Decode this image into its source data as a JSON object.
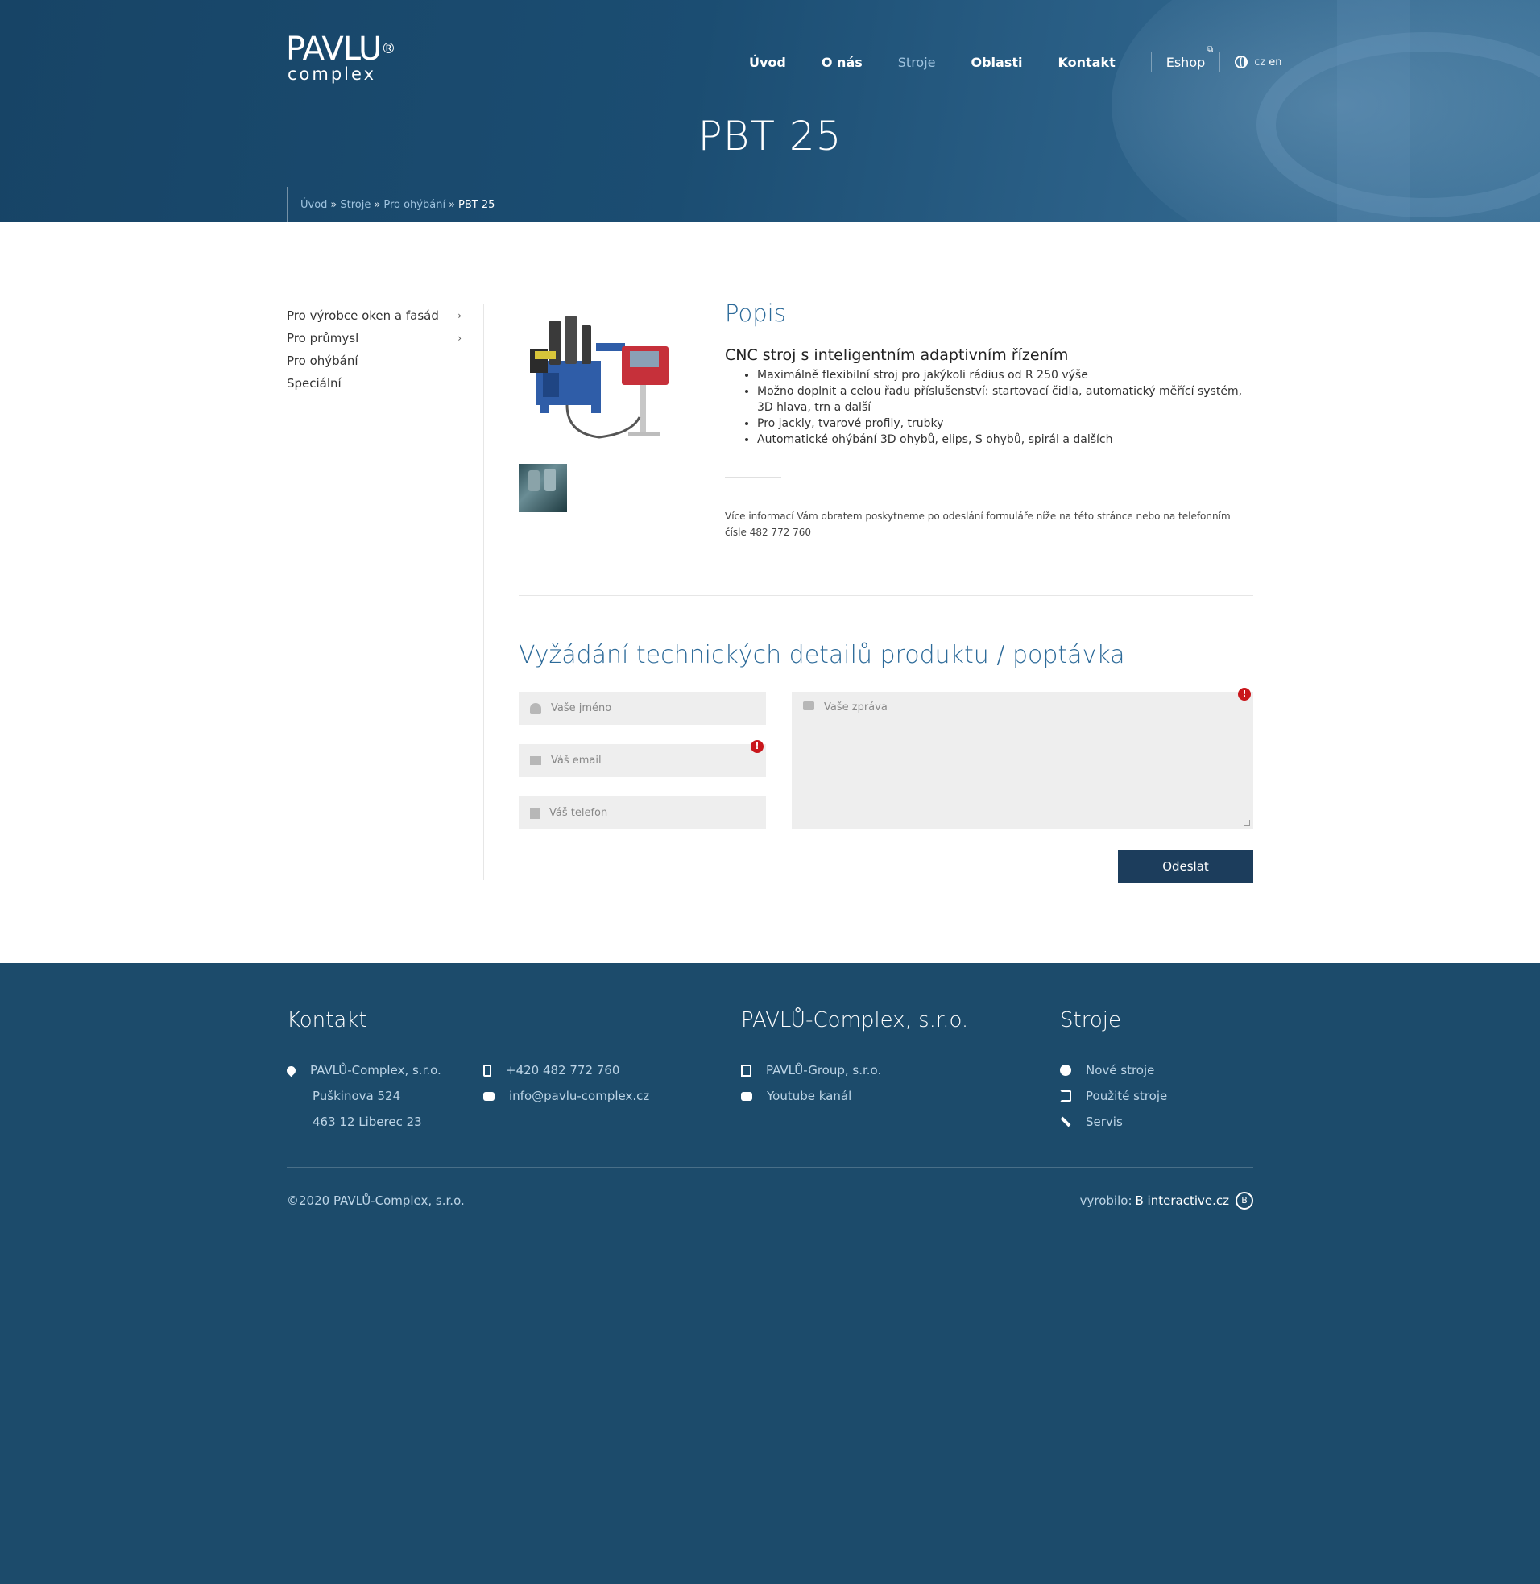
{
  "header": {
    "logo_top": "PAVLU",
    "logo_reg": "®",
    "logo_bottom": "complex",
    "nav": [
      "Úvod",
      "O nás",
      "Stroje",
      "Oblasti",
      "Kontakt"
    ],
    "nav_active": "Stroje",
    "eshop": "Eshop",
    "lang_cz": "cz",
    "lang_en": "en",
    "page_title": "PBT 25",
    "breadcrumb": [
      "Úvod",
      "Stroje",
      "Pro ohýbání",
      "PBT 25"
    ],
    "breadcrumb_sep": "»"
  },
  "sidebar": {
    "items": [
      {
        "label": "Pro výrobce oken a fasád",
        "has_sub": true
      },
      {
        "label": "Pro průmysl",
        "has_sub": true
      },
      {
        "label": "Pro ohýbání",
        "has_sub": false
      },
      {
        "label": "Speciální",
        "has_sub": false
      }
    ]
  },
  "description": {
    "heading": "Popis",
    "subheading": "CNC stroj s inteligentním adaptivním řízením",
    "bullets": [
      "Maximálně flexibilní stroj pro jakýkoli rádius od R 250 výše",
      "Možno doplnit a celou řadu příslušenství: startovací čidla, automatický měřící systém, 3D hlava, trn a další",
      "Pro jackly, tvarové profily, trubky",
      "Automatické ohýbání 3D ohybů, elips, S ohybů, spirál a dalších"
    ],
    "note": "Více informací Vám obratem poskytneme po odeslání formuláře níže na této stránce nebo na telefonním čísle 482 772 760"
  },
  "form": {
    "title": "Vyžádání technických detailů produktu / poptávka",
    "name_placeholder": "Vaše jméno",
    "email_placeholder": "Váš email",
    "phone_placeholder": "Váš telefon",
    "message_placeholder": "Vaše zpráva",
    "error_mark": "!",
    "submit": "Odeslat"
  },
  "footer": {
    "contact_heading": "Kontakt",
    "company": "PAVLŮ-Complex, s.r.o.",
    "street": "Puškinova 524",
    "city": "463 12 Liberec 23",
    "phone": "+420 482 772 760",
    "email": "info@pavlu-complex.cz",
    "group_heading": "PAVLŮ-Complex, s.r.o.",
    "group_link": "PAVLŮ-Group, s.r.o.",
    "youtube": "Youtube kanál",
    "machines_heading": "Stroje",
    "new_machines": "Nové stroje",
    "used_machines": "Použité stroje",
    "service": "Servis",
    "copyright": "©2020 PAVLŮ-Complex, s.r.o.",
    "made_by_label": "vyrobilo:",
    "made_by_brand": "B interactive.cz",
    "made_by_icon": "B"
  },
  "colors": {
    "header_blue": "#1b4d72",
    "footer_blue": "#1c4b6b",
    "accent_blue": "#2c6a99",
    "button_dark": "#1c3d5c",
    "error_red": "#c9161b"
  }
}
